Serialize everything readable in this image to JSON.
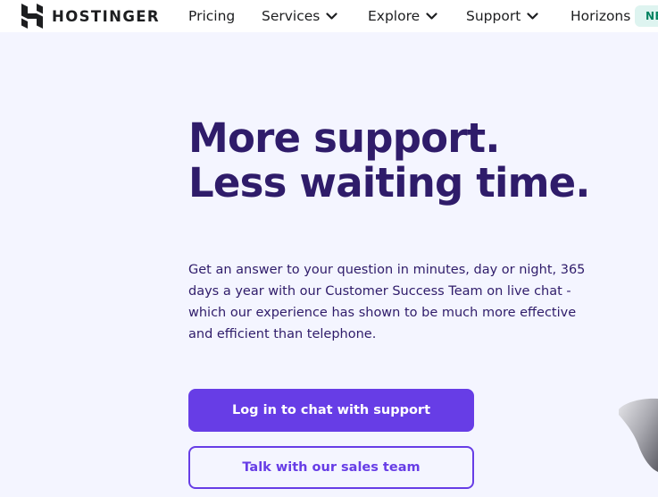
{
  "header": {
    "logo_text": "HOSTINGER",
    "nav": [
      {
        "label": "Pricing",
        "has_dropdown": false
      },
      {
        "label": "Services",
        "has_dropdown": true
      },
      {
        "label": "Explore",
        "has_dropdown": true
      },
      {
        "label": "Support",
        "has_dropdown": true
      },
      {
        "label": "Horizons",
        "has_dropdown": false
      }
    ],
    "horizons_badge": "NE"
  },
  "hero": {
    "title_line1": "More support.",
    "title_line2": "Less waiting time.",
    "description_lines": [
      "Get an answer to your question in minutes, day or night, 365",
      "days a year with our Customer Success Team on live chat -",
      "which our experience has shown to be much more effective",
      "and efficient than telephone."
    ],
    "primary_button": "Log in to chat with support",
    "secondary_button": "Talk with our sales team"
  },
  "colors": {
    "brand_primary": "#673de6",
    "heading_text": "#2f1c6a",
    "page_background": "#f4f5ff",
    "badge_background": "#def4f0",
    "badge_text": "#008361"
  },
  "icons": {
    "logo": "hostinger-logo-icon",
    "dropdown": "chevron-down-icon"
  }
}
